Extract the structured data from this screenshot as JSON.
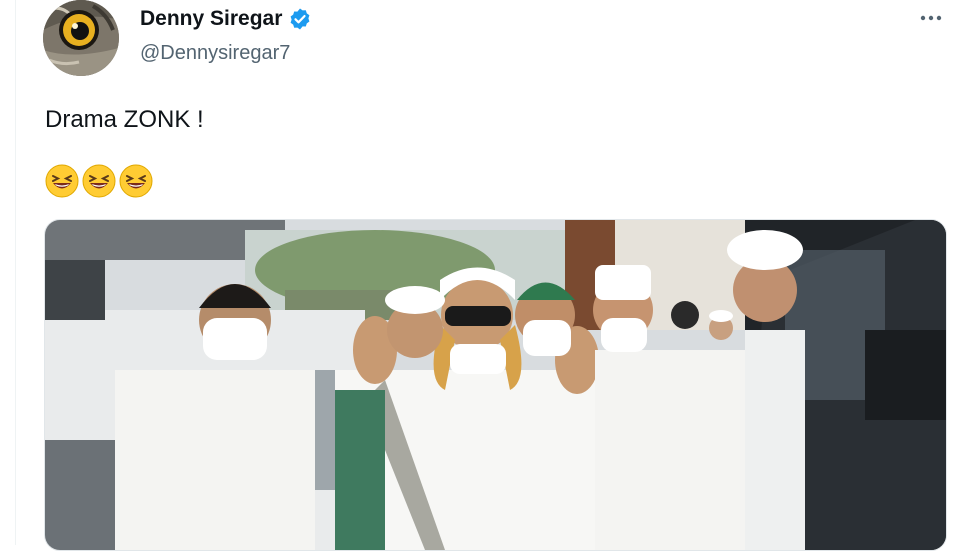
{
  "tweet": {
    "display_name": "Denny Siregar",
    "handle": "@Dennysiregar7",
    "text": "Drama ZONK !",
    "emojis": [
      "laughing-face",
      "laughing-face",
      "laughing-face"
    ],
    "verified": true
  },
  "icons": {
    "verified": "verified-badge-icon",
    "more": "more-options-icon"
  },
  "colors": {
    "verified_blue": "#1d9bf0",
    "secondary_text": "#536471",
    "primary_text": "#0f1419"
  }
}
